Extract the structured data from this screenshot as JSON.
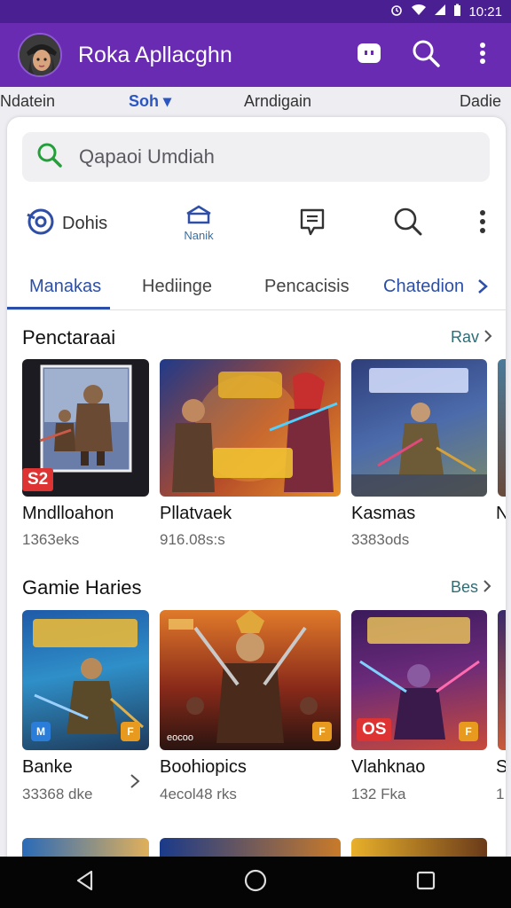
{
  "status_bar": {
    "time": "10:21"
  },
  "app_bar": {
    "title": "Roka Apllacghn"
  },
  "top_tabs": [
    {
      "label": "Ndatein"
    },
    {
      "label": "Soh ▾"
    },
    {
      "label": "Arndigain"
    },
    {
      "label": "Dadie"
    }
  ],
  "search": {
    "placeholder": "Qapaoi Umdiah"
  },
  "icon_row": {
    "first_label": "Dohis",
    "second_label": "Nanik"
  },
  "category_tabs": [
    {
      "label": "Manakas"
    },
    {
      "label": "Hediinge"
    },
    {
      "label": "Pencacisis"
    },
    {
      "label": "Chatedion"
    }
  ],
  "sections": [
    {
      "title": "Penctaraai",
      "more": "Rav",
      "items": [
        {
          "name": "Mndlloahon",
          "sub": "1363eks",
          "badge": "S2"
        },
        {
          "name": "Pllatvaek",
          "sub": "916.08s:s"
        },
        {
          "name": "Kasmas",
          "sub": "3383ods"
        },
        {
          "name": "N",
          "sub": ""
        }
      ]
    },
    {
      "title": "Gamie Haries",
      "more": "Bes",
      "items": [
        {
          "name": "Banke",
          "sub": "33368 dke"
        },
        {
          "name": "Boohiopics",
          "sub": "4ecol48 rks",
          "caption": "eocoo"
        },
        {
          "name": "Vlahknao",
          "sub": "132 Fka",
          "badge": "OS"
        },
        {
          "name": "S",
          "sub": "1"
        }
      ]
    }
  ],
  "colors": {
    "status_bar": "#4a1f92",
    "app_bar": "#6a2bb3",
    "accent": "#2b4fa8",
    "more": "#2f6c73"
  }
}
